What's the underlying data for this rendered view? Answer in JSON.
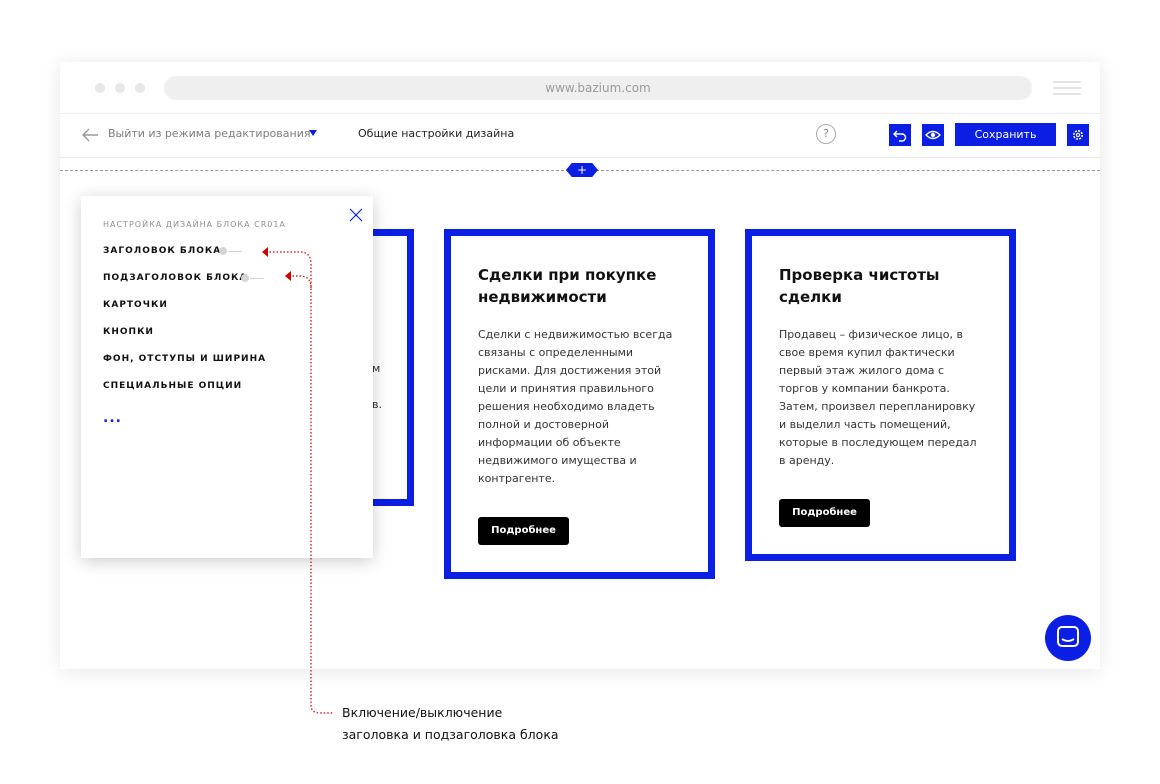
{
  "browser": {
    "url": "www.bazium.com"
  },
  "toolbar": {
    "exit_label": "Выйти из режима редактирования",
    "design_settings_label": "Общие настройки дизайна",
    "help_label": "?",
    "save_label": "Сохранить"
  },
  "add_block_label": "+",
  "panel": {
    "heading": "НАСТРОЙКА ДИЗАЙНА БЛОКА CR01A",
    "items": [
      {
        "label": "ЗАГОЛОВОК БЛОКА"
      },
      {
        "label": "ПОДЗАГОЛОВОК БЛОКА"
      },
      {
        "label": "КАРТОЧКИ"
      },
      {
        "label": "КНОПКИ"
      },
      {
        "label": "ФОН, ОТСТУПЫ И ШИРИНА"
      },
      {
        "label": "СПЕЦИАЛЬНЫЕ ОПЦИИ"
      }
    ],
    "more": "..."
  },
  "partial_card": {
    "frag1": "м",
    "frag2": "в."
  },
  "cards": [
    {
      "title_line1": "Сделки при покупке",
      "title_line2": "недвижимости",
      "text_lines": [
        "Сделки с недвижимостью всегда",
        "связаны с определенными",
        "рисками. Для достижения этой",
        "цели и принятия правильного",
        "решения необходимо владеть",
        "полной и достоверной",
        "информации об объекте",
        "недвижимого имущества и",
        "контрагенте."
      ],
      "button": "Подробнее"
    },
    {
      "title_line1": "Проверка чистоты",
      "title_line2": "сделки",
      "text_lines": [
        "Продавец – физическое лицо, в",
        "свое время купил фактически",
        "первый этаж жилого дома с",
        "торгов у компании банкрота.",
        "Затем, произвел перепланировку",
        "и выделил часть помещений,",
        "которые в последующем передал",
        "в аренду."
      ],
      "button": "Подробнее"
    }
  ],
  "annotation": {
    "line1": "Включение/выключение",
    "line2": "заголовка и подзаголовка блока"
  },
  "colors": {
    "accent": "#0a1fe3",
    "annotation": "#cc0000",
    "button_dark": "#000000"
  }
}
